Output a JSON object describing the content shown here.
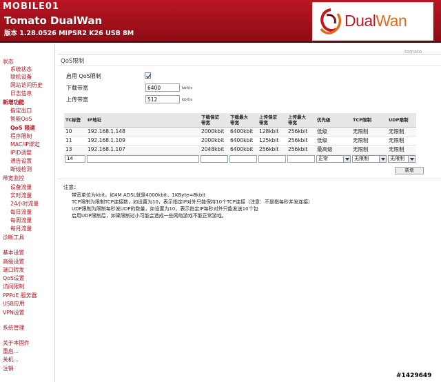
{
  "watermark": {
    "top_brand": "MOBILE01",
    "bottom_id": "#1429649"
  },
  "header": {
    "title": "Tomato DualWan",
    "version": "版本 1.28.0526 MIPSR2 K26 USB 8M",
    "logo_text_dual": "Dual",
    "logo_text_wan": "Wan",
    "colors": {
      "header_red": "#a5111c",
      "logo_red": "#c3161f",
      "logo_orange": "#e06a1a"
    }
  },
  "sidebar": {
    "items": [
      {
        "label": "状态",
        "level": 0
      },
      {
        "label": "系统状态",
        "level": 1
      },
      {
        "label": "联机设备",
        "level": 1
      },
      {
        "label": "网站访问历史",
        "level": 1
      },
      {
        "label": "日志信息",
        "level": 1
      },
      {
        "label": "新增功能",
        "level": 0
      },
      {
        "label": "指定出口",
        "level": 1
      },
      {
        "label": "智能QoS",
        "level": 1
      },
      {
        "label": "QoS 限速",
        "level": 1
      },
      {
        "label": "程序限制",
        "level": 1
      },
      {
        "label": "MAC/IP绑定",
        "level": 1
      },
      {
        "label": "IPID调整",
        "level": 1
      },
      {
        "label": "通告设置",
        "level": 1
      },
      {
        "label": "断线检测",
        "level": 1
      },
      {
        "label": "带宽监控",
        "level": 0
      },
      {
        "label": "设备流量",
        "level": 1
      },
      {
        "label": "实时流量",
        "level": 1
      },
      {
        "label": "24小时流量",
        "level": 1
      },
      {
        "label": "每日流量",
        "level": 1
      },
      {
        "label": "每周流量",
        "level": 1
      },
      {
        "label": "每月流量",
        "level": 1
      },
      {
        "label": "诊断工具",
        "level": 0
      },
      {
        "label": "基本设置",
        "level": 0
      },
      {
        "label": "高级设置",
        "level": 0
      },
      {
        "label": "端口转发",
        "level": 0
      },
      {
        "label": "QoS设置",
        "level": 0
      },
      {
        "label": "访问限制",
        "level": 0
      },
      {
        "label": "PPPoE 服务器",
        "level": 0
      },
      {
        "label": "USB应用",
        "level": 0
      },
      {
        "label": "VPN设置",
        "level": 0
      },
      {
        "label": "系统管理",
        "level": 0
      },
      {
        "label": "关于本固件",
        "level": 0
      },
      {
        "label": "重启...",
        "level": 0
      },
      {
        "label": "关机...",
        "level": 0
      },
      {
        "label": "注销",
        "level": 0
      }
    ]
  },
  "main": {
    "breadcrumb": "tomato",
    "section_title": "QoS限制",
    "enable_label": "启用 QoS限制",
    "enable_checked": true,
    "download_label": "下载带宽",
    "download_value": "6400",
    "upload_label": "上传带宽",
    "upload_value": "512",
    "unit": "kbit/s"
  },
  "table": {
    "headers": {
      "tc": "TC标签",
      "ip": "IP地址",
      "dl_min_1": "下载保证",
      "dl_min_2": "带宽",
      "dl_max_1": "下载最大",
      "dl_max_2": "带宽",
      "ul_min_1": "上传保证",
      "ul_min_2": "带宽",
      "ul_max_1": "上传最大",
      "ul_max_2": "带宽",
      "priority": "优先级",
      "tcp": "TCP限制",
      "udp": "UDP限制"
    },
    "rows": [
      {
        "tc": "10",
        "ip": "192.168.1.148",
        "dl_min": "2000kbit",
        "dl_max": "6400kbit",
        "ul_min": "128kbit",
        "ul_max": "256kbit",
        "priority": "低级",
        "tcp": "无限制",
        "udp": "无限制"
      },
      {
        "tc": "11",
        "ip": "192.168.1.109",
        "dl_min": "2000kbit",
        "dl_max": "6400kbit",
        "ul_min": "125kbit",
        "ul_max": "256kbit",
        "priority": "低级",
        "tcp": "无限制",
        "udp": "无限制"
      },
      {
        "tc": "13",
        "ip": "192.168.1.107",
        "dl_min": "2048kbit",
        "dl_max": "6400kbit",
        "ul_min": "256kbit",
        "ul_max": "256kbit",
        "priority": "最高级",
        "tcp": "无限制",
        "udp": "无限制"
      }
    ],
    "new_row": {
      "tc": "14",
      "priority": "正常",
      "tcp": "无限制",
      "udp": "无限制"
    },
    "add_label": "新增"
  },
  "notes": {
    "title": "注意：",
    "lines": [
      "带宽单位为kbit，如4M ADSL就是4000kbit，1KByte=8kbit",
      "TCP限制为限制TCP连接数，如设置为10，表示指定IP对外只能保持10个TCP连接（注意：不是指每秒并发连接）",
      "UDP限制为限制每秒发UDP的数量，如设置为10，表示指定IP每秒对外只能发送10个包",
      "启用UDP限制后，如果限制过小可能会造成一些网络游戏不能正常游戏。"
    ]
  }
}
